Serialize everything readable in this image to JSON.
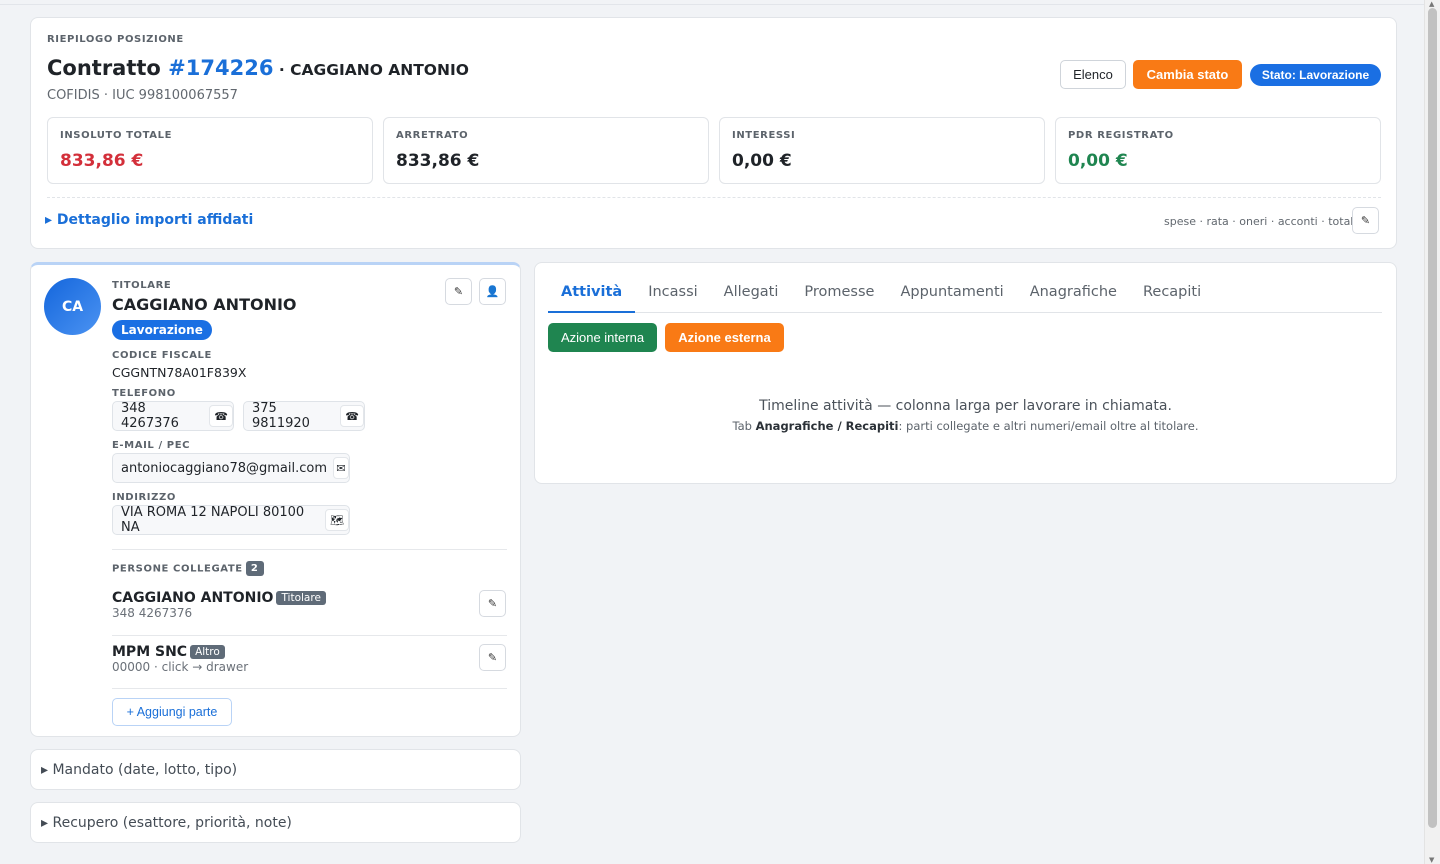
{
  "summary": {
    "label": "RIEPILOGO POSIZIONE",
    "title_prefix": "Contratto",
    "contract_number": "#174226",
    "title_sep": " · ",
    "debtor_name": "CAGGIANO ANTONIO",
    "subtitle": "COFIDIS · IUC 998100067557",
    "buttons": {
      "elenco": "Elenco",
      "cambia_stato": "Cambia stato",
      "stato": "Stato: Lavorazione"
    },
    "metrics": [
      {
        "label": "INSOLUTO TOTALE",
        "value": "833,86 €",
        "color": "#d32f3a"
      },
      {
        "label": "ARRETRATO",
        "value": "833,86 €",
        "color": "#1f2328"
      },
      {
        "label": "INTERESSI",
        "value": "0,00 €",
        "color": "#1f2328"
      },
      {
        "label": "PDR REGISTRATO",
        "value": "0,00 €",
        "color": "#1f8550"
      }
    ],
    "details_link": "▸ Dettaglio importi affidati",
    "details_hint": "spese · rata · oneri · acconti · totale",
    "edit_icon": "✎"
  },
  "person": {
    "initials": "CA",
    "role_label": "TITOLARE",
    "name": "CAGGIANO ANTONIO",
    "status_badge": "Lavorazione",
    "edit_icon": "✎",
    "user_icon": "👤",
    "fiscal_code_label": "CODICE FISCALE",
    "fiscal_code": "CGGNTN78A01F839X",
    "phone_label": "TELEFONO",
    "phones": [
      "348 4267376",
      "375 9811920"
    ],
    "phone_icon": "☎",
    "email_label": "E-MAIL / PEC",
    "email": "antoniocaggiano78@gmail.com",
    "email_icon": "✉",
    "address_label": "INDIRIZZO",
    "address": "VIA ROMA 12 NAPOLI 80100 NA",
    "map_icon": "🗺",
    "linked_label": "PERSONE COLLEGATE",
    "linked_count": "2",
    "linked": [
      {
        "name": "CAGGIANO ANTONIO",
        "tag": "Titolare",
        "sub": "348 4267376"
      },
      {
        "name": "MPM SNC",
        "tag": "Altro",
        "sub": "00000 · click → drawer"
      }
    ],
    "add_party": "+ Aggiungi parte"
  },
  "sections": {
    "mandato": "▸ Mandato (date, lotto, tipo)",
    "recupero": "▸ Recupero (esattore, priorità, note)"
  },
  "activity": {
    "tabs": [
      "Attività",
      "Incassi",
      "Allegati",
      "Promesse",
      "Appuntamenti",
      "Anagrafiche",
      "Recapiti"
    ],
    "active_tab": "Attività",
    "btn_internal": "Azione interna",
    "btn_external": "Azione esterna",
    "timeline_text": "Timeline attività — colonna larga per lavorare in chiamata.",
    "hint_prefix": "Tab ",
    "hint_b1": "Anagrafiche",
    "hint_sep": " / ",
    "hint_b2": "Recapiti",
    "hint_suffix": ": parti collegate e altri numeri/email oltre al titolare."
  }
}
